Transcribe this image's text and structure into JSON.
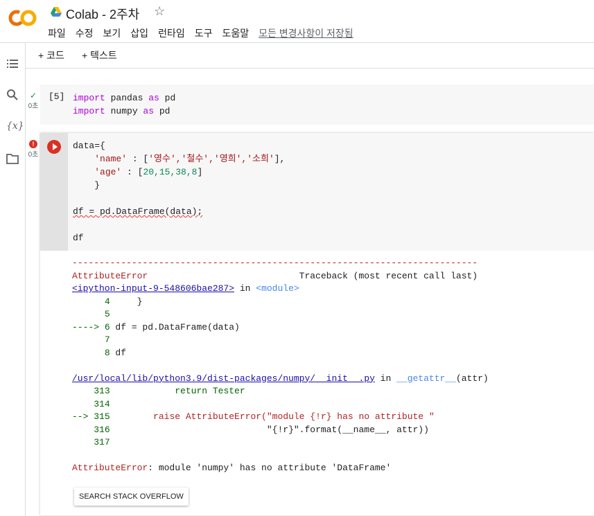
{
  "app": {
    "logo_text": "CO",
    "title": "Colab - 2주차",
    "star_icon": "star-outline-icon"
  },
  "menu": {
    "items": [
      "파일",
      "수정",
      "보기",
      "삽입",
      "런타임",
      "도구",
      "도움말"
    ],
    "save_status": "모든 변경사항이 저장됨"
  },
  "toolbar": {
    "add_code": "+ 코드",
    "add_text": "+ 텍스트"
  },
  "sidebar": {
    "icons": [
      "table-of-contents-icon",
      "search-icon",
      "variables-icon",
      "files-icon"
    ],
    "variables_label": "{x}"
  },
  "cells": [
    {
      "exec_count": "[5]",
      "status": "0초",
      "status_icon": "check-icon",
      "lines": [
        {
          "kw": "import",
          "rest": " pandas ",
          "kw2": "as",
          "rest2": " pd"
        },
        {
          "kw": "import",
          "rest": " numpy ",
          "kw2": "as",
          "rest2": " pd"
        }
      ]
    },
    {
      "status": "0초",
      "status_icon": "error-icon",
      "code": {
        "l1": "data={",
        "l2_key": "'name'",
        "l2_mid": " : [",
        "l2_vals": "'영수','철수','영희','소희'",
        "l2_end": "],",
        "l3_key": "'age'",
        "l3_mid": " : [",
        "l3_vals": "20,15,38,8",
        "l3_end": "]",
        "l4": "    }",
        "l5": "df = pd.DataFrame(data);",
        "l6": "df"
      }
    }
  ],
  "output": {
    "sep": "---------------------------------------------------------------------------",
    "err_name": "AttributeError",
    "traceback_hdr": "                            Traceback (most recent call last)",
    "input_link": "<ipython-input-9-548606bae287>",
    "in_word": " in ",
    "module": "<module>",
    "tb1": [
      {
        "arrow": "      ",
        "num": "4",
        "code": "     }"
      },
      {
        "arrow": "      ",
        "num": "5",
        "code": ""
      },
      {
        "arrow": "----> ",
        "num": "6",
        "code": " df = pd.DataFrame(data)"
      },
      {
        "arrow": "      ",
        "num": "7",
        "code": ""
      },
      {
        "arrow": "      ",
        "num": "8",
        "code": " df"
      }
    ],
    "file_link": "/usr/local/lib/python3.9/dist-packages/numpy/__init__.py",
    "getattr": "__getattr__",
    "getattr_arg": "(attr)",
    "tb2": [
      {
        "arrow": "    ",
        "num": "313",
        "code": "            return Tester"
      },
      {
        "arrow": "    ",
        "num": "314",
        "code": ""
      },
      {
        "arrow": "--> ",
        "num": "315",
        "code": "        raise AttributeError(\"module {!r} has no attribute \""
      },
      {
        "arrow": "    ",
        "num": "316",
        "code": "                             \"{!r}\".format(__name__, attr))"
      },
      {
        "arrow": "    ",
        "num": "317",
        "code": ""
      }
    ],
    "final_err": "AttributeError",
    "final_msg": ": module 'numpy' has no attribute 'DataFrame'",
    "so_button": "SEARCH STACK OVERFLOW"
  }
}
